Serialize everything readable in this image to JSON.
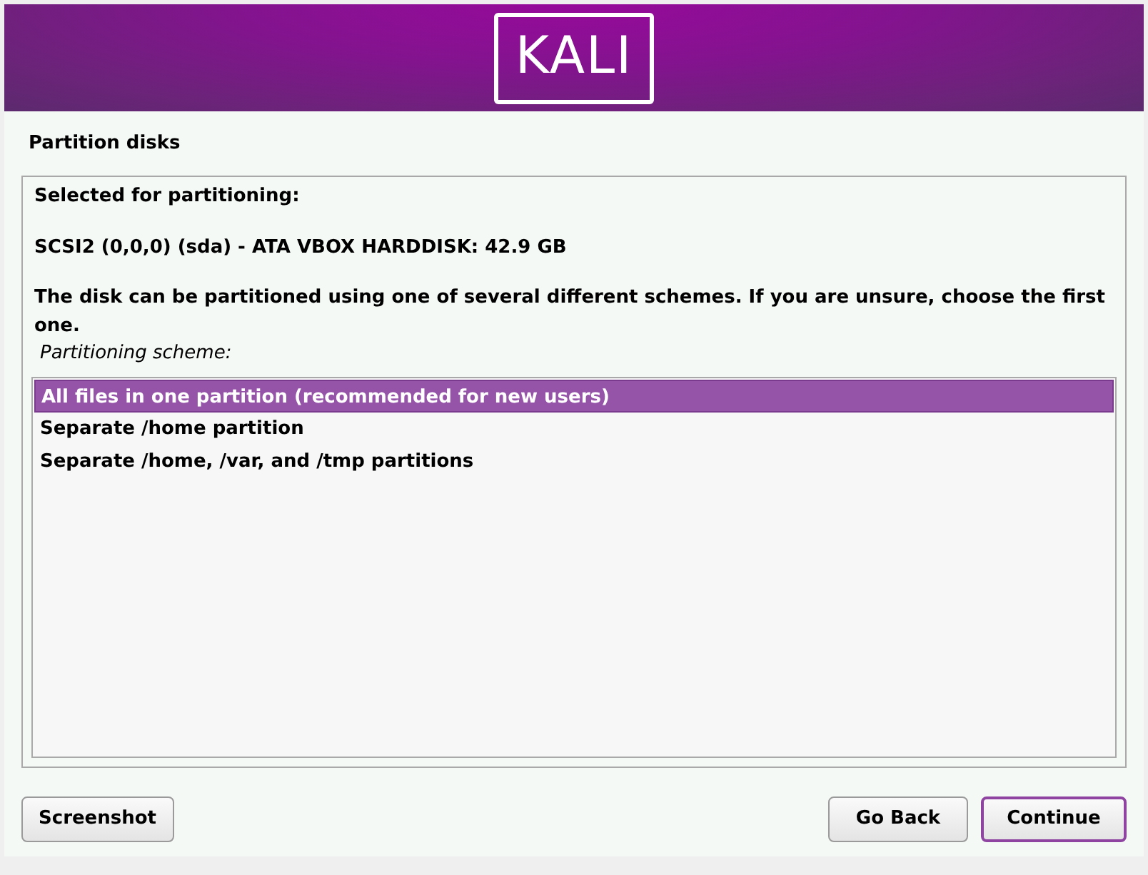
{
  "banner": {
    "logo": "KALI"
  },
  "step_title": "Partition disks",
  "selected_label": "Selected for partitioning:",
  "disk": "SCSI2 (0,0,0) (sda) - ATA VBOX HARDDISK: 42.9 GB",
  "instructions": "The disk can be partitioned using one of several different schemes. If you are unsure, choose the first one.",
  "list_label": "Partitioning scheme:",
  "options": [
    {
      "label": "All files in one partition (recommended for new users)",
      "selected": true
    },
    {
      "label": "Separate /home partition",
      "selected": false
    },
    {
      "label": "Separate /home, /var, and /tmp partitions",
      "selected": false
    }
  ],
  "buttons": [
    {
      "label": "Screenshot",
      "kind": "left",
      "default": false
    },
    {
      "label": "Go Back",
      "kind": "right",
      "default": false
    },
    {
      "label": "Continue",
      "kind": "right",
      "default": true
    }
  ]
}
